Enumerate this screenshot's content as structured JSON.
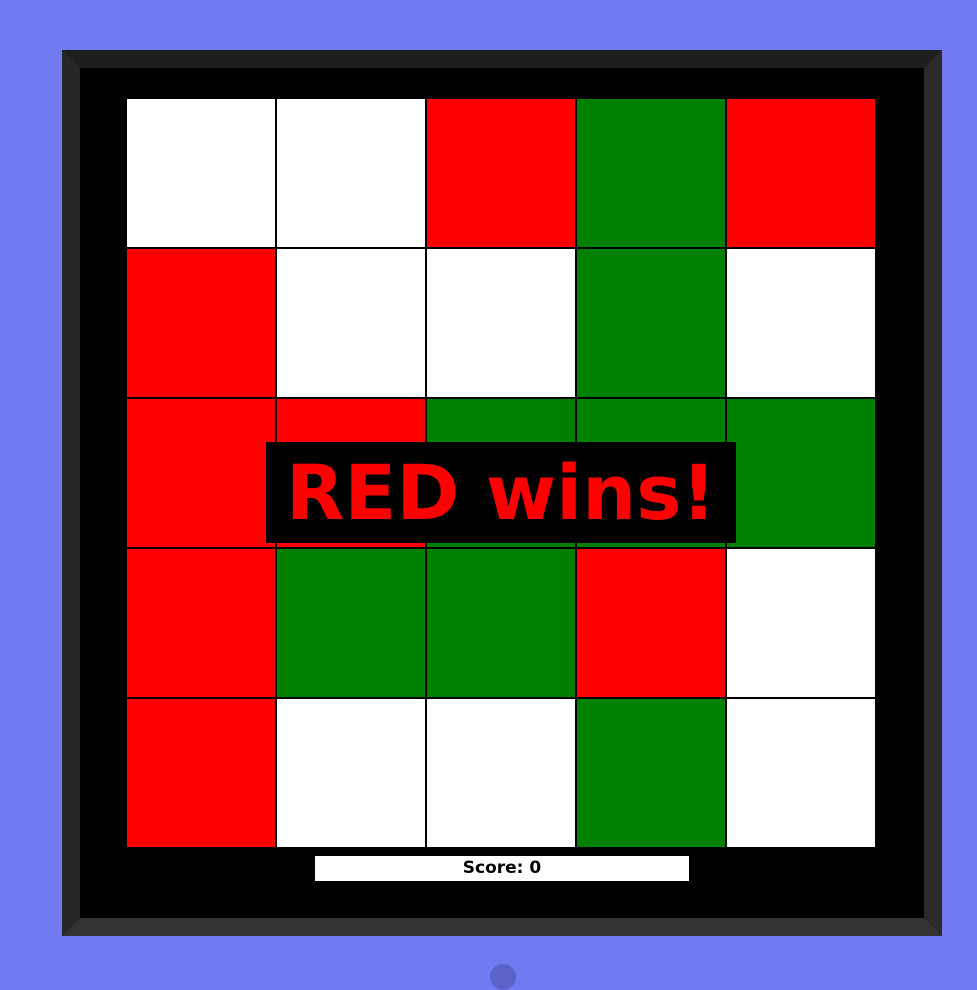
{
  "colors": {
    "red": "#ff0000",
    "green": "#008000",
    "white": "#ffffff"
  },
  "board": [
    [
      "white",
      "white",
      "red",
      "green",
      "red"
    ],
    [
      "red",
      "white",
      "white",
      "green",
      "white"
    ],
    [
      "red",
      "red",
      "green",
      "green",
      "green"
    ],
    [
      "red",
      "green",
      "green",
      "red",
      "white"
    ],
    [
      "red",
      "white",
      "white",
      "green",
      "white"
    ]
  ],
  "message": "RED wins!",
  "score_label": "Score: 0"
}
